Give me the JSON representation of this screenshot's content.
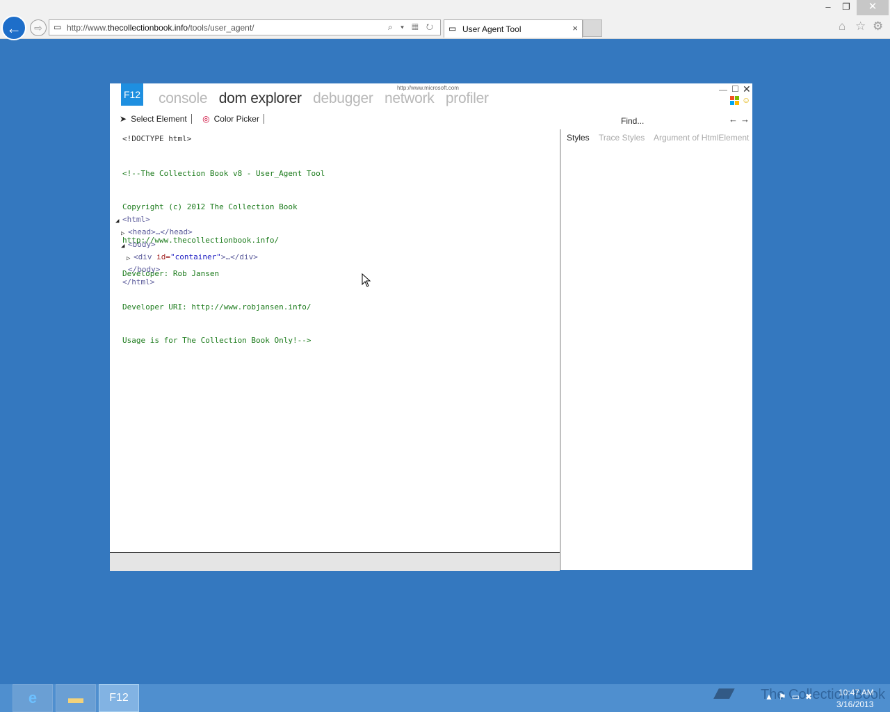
{
  "browser": {
    "url_prefix": "http://www.",
    "url_domain": "thecollectionbook.info",
    "url_path": "/tools/user_agent/",
    "tab_title": "User Agent Tool",
    "tab_close": "×",
    "minimize": "–",
    "restore": "❐",
    "close": "✕",
    "back": "←",
    "forward": "⇨"
  },
  "icons": {
    "page_icon": "page-icon",
    "search": "⌕ ▾ ▦ ↻",
    "home": "⌂",
    "favorites": "☆",
    "settings": "⚙"
  },
  "devtools": {
    "logo": "F12",
    "ms_url": "http://www.microsoft.com",
    "tabs": [
      "console",
      "dom explorer",
      "debugger",
      "network",
      "profiler"
    ],
    "active_tab": "dom explorer",
    "toolbar": {
      "select_element": "Select Element",
      "color_picker": "Color Picker"
    },
    "find_placeholder": "Find...",
    "find_prev": "←",
    "find_next": "→",
    "dom": {
      "doctype": "<!DOCTYPE html>",
      "comment_lines": [
        "<!--The Collection Book v8 - User_Agent Tool",
        "Copyright (c) 2012 The Collection Book",
        "http://www.thecollectionbook.info/",
        "Developer: Rob Jansen",
        "Developer URI: http://www.robjansen.info/",
        "Usage is for The Collection Book Only!-->"
      ],
      "html_open": "<html>",
      "head": "<head>…</head>",
      "body_open": "<body>",
      "div_open": "<div ",
      "div_attr_name": "id=",
      "div_attr_value": "\"container\"",
      "div_rest": ">…</div>",
      "body_close": "</body>",
      "html_close": "</html>"
    },
    "right_tabs": [
      "Styles",
      "Trace Styles",
      "Argument of HtmlElement"
    ]
  },
  "taskbar": {
    "f12_label": "F12",
    "watermark": "The Collection Book",
    "time": "10:47 AM",
    "date": "3/16/2013"
  },
  "colors": {
    "desktop": "#3478bf",
    "f12_blue": "#1e8fe0",
    "taskbar": "#4f8fcf"
  }
}
